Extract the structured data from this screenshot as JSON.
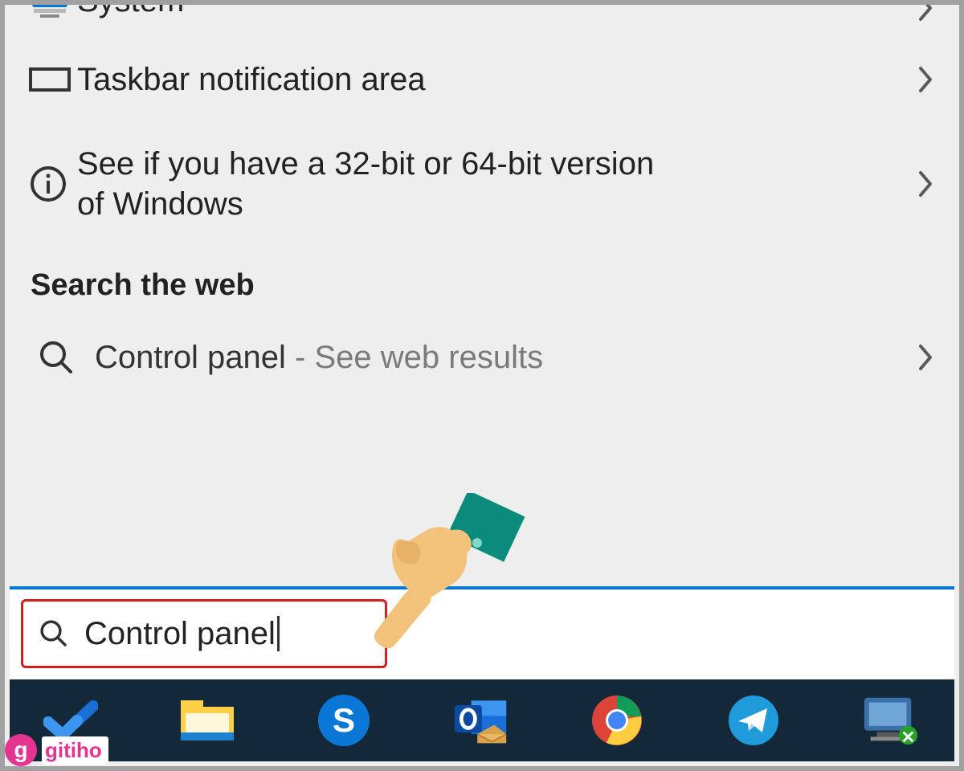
{
  "results": {
    "system": {
      "label": "System"
    },
    "taskbar_area": {
      "label": "Taskbar notification area"
    },
    "bitness": {
      "label": "See if you have a 32-bit or 64-bit version of Windows"
    }
  },
  "section_header": "Search the web",
  "web_result": {
    "label": "Control panel",
    "suffix": " - See web results"
  },
  "search": {
    "value": "Control panel"
  },
  "watermark": {
    "badge": "g",
    "text": "gitiho"
  },
  "taskbar_icons": [
    "todo-icon",
    "file-explorer-icon",
    "skype-icon",
    "outlook-icon",
    "chrome-icon",
    "telegram-icon",
    "remote-desktop-icon"
  ]
}
